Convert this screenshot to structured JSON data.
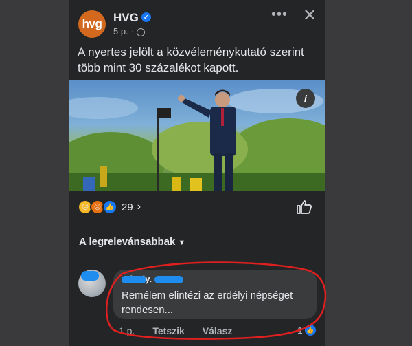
{
  "post": {
    "page_name": "HVG",
    "avatar_text": "hvg",
    "time": "5 p.",
    "caption": "A nyertes jelölt a közvéleménykutató szerint több mint 30 százalékot kapott.",
    "reaction_count": "29",
    "icons": [
      "more-icon",
      "close-icon",
      "globe-icon",
      "verified-icon",
      "info-icon",
      "like-icon"
    ]
  },
  "comments": {
    "sort_label": "A legrelevánsabbak",
    "items": [
      {
        "author": "A    ka    ly.",
        "text": "Remélem elintézi az erdélyi népséget rendesen...",
        "time": "1 p.",
        "like_label": "Tetszik",
        "reply_label": "Válasz",
        "likes": "1"
      }
    ]
  },
  "colors": {
    "accent": "#1877f2",
    "brand": "#d2691e",
    "annotation": "#e02020",
    "background": "#242526"
  }
}
